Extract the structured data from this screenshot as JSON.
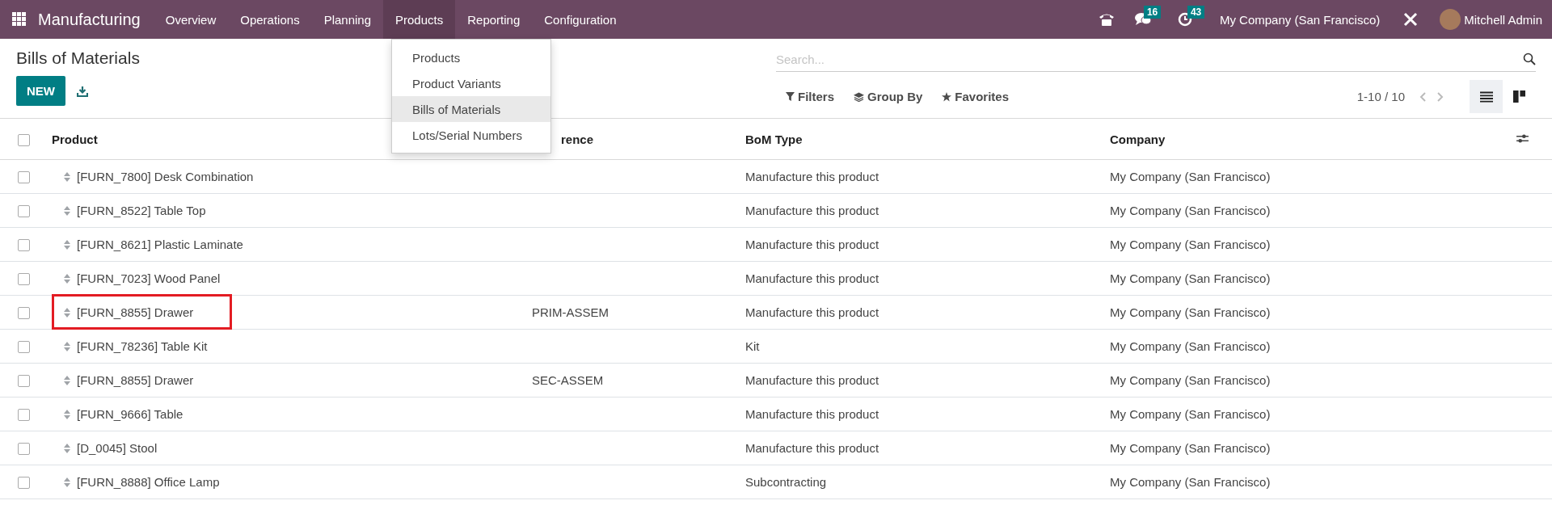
{
  "navbar": {
    "app_name": "Manufacturing",
    "menu": [
      {
        "label": "Overview",
        "selected": false
      },
      {
        "label": "Operations",
        "selected": false
      },
      {
        "label": "Planning",
        "selected": false
      },
      {
        "label": "Products",
        "selected": true
      },
      {
        "label": "Reporting",
        "selected": false
      },
      {
        "label": "Configuration",
        "selected": false
      }
    ],
    "messages_badge": "16",
    "activities_badge": "43",
    "company": "My Company (San Francisco)",
    "user": "Mitchell Admin"
  },
  "dropdown": {
    "items": [
      {
        "label": "Products",
        "selected": false
      },
      {
        "label": "Product Variants",
        "selected": false
      },
      {
        "label": "Bills of Materials",
        "selected": true
      },
      {
        "label": "Lots/Serial Numbers",
        "selected": false
      }
    ]
  },
  "control_panel": {
    "title": "Bills of Materials",
    "new_button": "NEW",
    "search": {
      "placeholder": "Search..."
    },
    "filters": "Filters",
    "group_by": "Group By",
    "favorites": "Favorites",
    "pager": "1-10 / 10",
    "views": [
      {
        "kind": "list",
        "selected": true
      },
      {
        "kind": "kanban",
        "selected": false
      }
    ]
  },
  "table": {
    "select_all": {
      "checked": false
    },
    "columns": [
      "Product",
      "rence",
      "BoM Type",
      "Company"
    ],
    "rows": [
      {
        "checked": false,
        "highlighted": false,
        "product": "[FURN_7800] Desk Combination",
        "reference": "",
        "bom_type": "Manufacture this product",
        "company": "My Company (San Francisco)"
      },
      {
        "checked": false,
        "highlighted": false,
        "product": "[FURN_8522] Table Top",
        "reference": "",
        "bom_type": "Manufacture this product",
        "company": "My Company (San Francisco)"
      },
      {
        "checked": false,
        "highlighted": false,
        "product": "[FURN_8621] Plastic Laminate",
        "reference": "",
        "bom_type": "Manufacture this product",
        "company": "My Company (San Francisco)"
      },
      {
        "checked": false,
        "highlighted": false,
        "product": "[FURN_7023] Wood Panel",
        "reference": "",
        "bom_type": "Manufacture this product",
        "company": "My Company (San Francisco)"
      },
      {
        "checked": false,
        "highlighted": true,
        "product": "[FURN_8855] Drawer",
        "reference": "PRIM-ASSEM",
        "bom_type": "Manufacture this product",
        "company": "My Company (San Francisco)"
      },
      {
        "checked": false,
        "highlighted": false,
        "product": "[FURN_78236] Table Kit",
        "reference": "",
        "bom_type": "Kit",
        "company": "My Company (San Francisco)"
      },
      {
        "checked": false,
        "highlighted": false,
        "product": "[FURN_8855] Drawer",
        "reference": "SEC-ASSEM",
        "bom_type": "Manufacture this product",
        "company": "My Company (San Francisco)"
      },
      {
        "checked": false,
        "highlighted": false,
        "product": "[FURN_9666] Table",
        "reference": "",
        "bom_type": "Manufacture this product",
        "company": "My Company (San Francisco)"
      },
      {
        "checked": false,
        "highlighted": false,
        "product": "[D_0045] Stool",
        "reference": "",
        "bom_type": "Manufacture this product",
        "company": "My Company (San Francisco)"
      },
      {
        "checked": false,
        "highlighted": false,
        "product": "[FURN_8888] Office Lamp",
        "reference": "",
        "bom_type": "Subcontracting",
        "company": "My Company (San Francisco)"
      }
    ]
  }
}
